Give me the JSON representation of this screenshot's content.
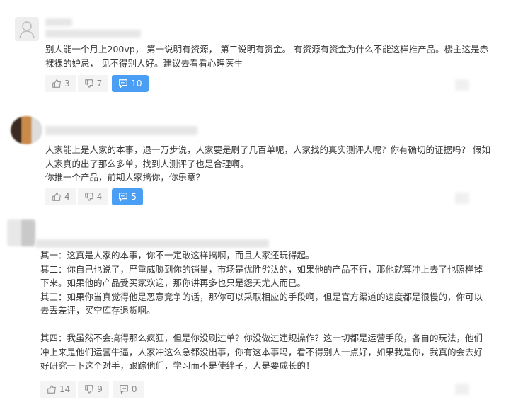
{
  "comments": [
    {
      "text": "别人能一个月上200vp， 第一说明有资源， 第二说明有资金。 有资源有资金为什么不能这样推产品。楼主这是赤裸裸的妒忌， 见不得别人好。建议去看看心理医生",
      "likes": "3",
      "dislikes": "7",
      "replies": "10",
      "replies_active": true
    },
    {
      "text": "人家能上是人家的本事，退一万步说，人家要是刷了几百单呢，人家找的真实测评人呢？你有确切的证据吗？ 假如人家真的出了那么多单，找到人测评了也是合理啊。\n你推一个产品，前期人家搞你，你乐意？",
      "likes": "4",
      "dislikes": "4",
      "replies": "5",
      "replies_active": true
    },
    {
      "text": "其一：这真是人家的本事，你不一定敢这样搞啊，而且人家还玩得起。\n其二：你自己也说了，严重威胁到你的销量，市场是优胜劣汰的，如果他的产品不行，那他就算冲上去了也照样掉下来。如果他的产品受买家欢迎，那你讲再多也只是怨天尤人而已。\n其三：如果你当真觉得他是恶意竞争的话，那你可以采取相应的手段啊，但是官方渠道的速度都是很慢的，你可以去丢差评，买空库存退货啊。\n\n其四：我虽然不会搞得那么疯狂，但是你没刷过单？你没做过违规操作？这一切都是运营手段，各自的玩法，他们冲上来是他们运营牛逼，人家冲这么急都没出事，你有这本事吗，看不得别人一点好，如果我是你，我真的会去好好研究一下这个对手，跟踪他们，学习而不是使绊子，人是要成长的！",
      "likes": "14",
      "dislikes": "9",
      "replies": "0",
      "replies_active": false
    }
  ],
  "colors": {
    "accent": "#4a9ff5",
    "button_bg": "#f4f4f4",
    "text": "#3a3a3a"
  }
}
